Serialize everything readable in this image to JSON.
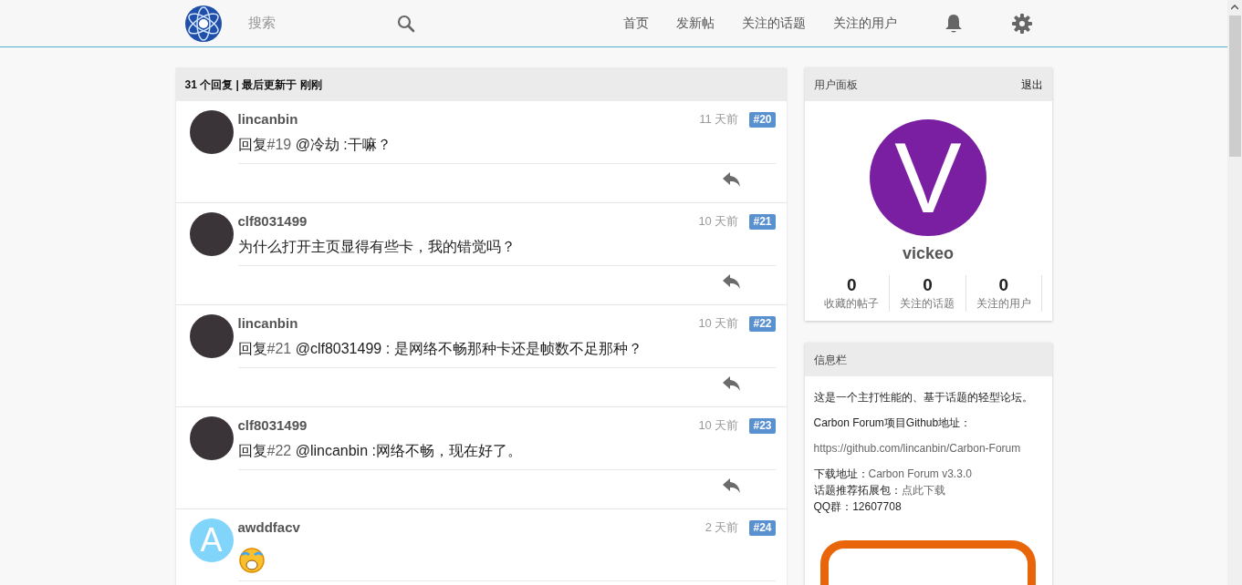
{
  "header": {
    "search": {
      "placeholder": "搜索"
    },
    "nav": [
      {
        "label": "首页"
      },
      {
        "label": "发新帖"
      },
      {
        "label": "关注的话题"
      },
      {
        "label": "关注的用户"
      }
    ]
  },
  "replies_bar": {
    "summary": "31 个回复 | 最后更新于 刚刚"
  },
  "posts": [
    {
      "author": "lincanbin",
      "time": "11 天前",
      "floor": "#20",
      "avatar": {
        "kind": "photo"
      },
      "content": {
        "kind": "reply",
        "prefix": "回复",
        "ref": "#19",
        "text": " @冷劫 :干嘛？"
      }
    },
    {
      "author": "clf8031499",
      "time": "10 天前",
      "floor": "#21",
      "avatar": {
        "kind": "photo"
      },
      "content": {
        "kind": "text",
        "text": "为什么打开主页显得有些卡，我的错觉吗？"
      }
    },
    {
      "author": "lincanbin",
      "time": "10 天前",
      "floor": "#22",
      "avatar": {
        "kind": "photo"
      },
      "content": {
        "kind": "reply",
        "prefix": "回复",
        "ref": "#21",
        "text": " @clf8031499 : 是网络不畅那种卡还是帧数不足那种？"
      }
    },
    {
      "author": "clf8031499",
      "time": "10 天前",
      "floor": "#23",
      "avatar": {
        "kind": "photo"
      },
      "content": {
        "kind": "reply",
        "prefix": "回复",
        "ref": "#22",
        "text": " @lincanbin :网络不畅，现在好了。"
      }
    },
    {
      "author": "awddfacv",
      "time": "2 天前",
      "floor": "#24",
      "avatar": {
        "kind": "letter",
        "letter": "A",
        "color": "#81d4fa"
      },
      "content": {
        "kind": "emoji"
      }
    }
  ],
  "user_panel": {
    "title": "用户面板",
    "logout": "退出",
    "avatar": {
      "letter": "V",
      "color": "#7b1fa2"
    },
    "username": "vickeo",
    "stats": [
      {
        "value": "0",
        "label": "收藏的帖子"
      },
      {
        "value": "0",
        "label": "关注的话题"
      },
      {
        "value": "0",
        "label": "关注的用户"
      }
    ]
  },
  "info_panel": {
    "title": "信息栏",
    "paragraphs": [
      {
        "kind": "text",
        "text": "这是一个主打性能的、基于话题的轻型论坛。"
      },
      {
        "kind": "text",
        "text": "Carbon Forum项目Github地址："
      },
      {
        "kind": "link",
        "text": "https://github.com/lincanbin/Carbon-Forum"
      },
      {
        "kind": "lines",
        "lines": [
          {
            "label": "下载地址：",
            "link": "Carbon Forum v3.3.0"
          },
          {
            "label": "话题推荐拓展包：",
            "link": "点此下载"
          },
          {
            "label": "QQ群：12607708"
          }
        ]
      }
    ]
  }
}
